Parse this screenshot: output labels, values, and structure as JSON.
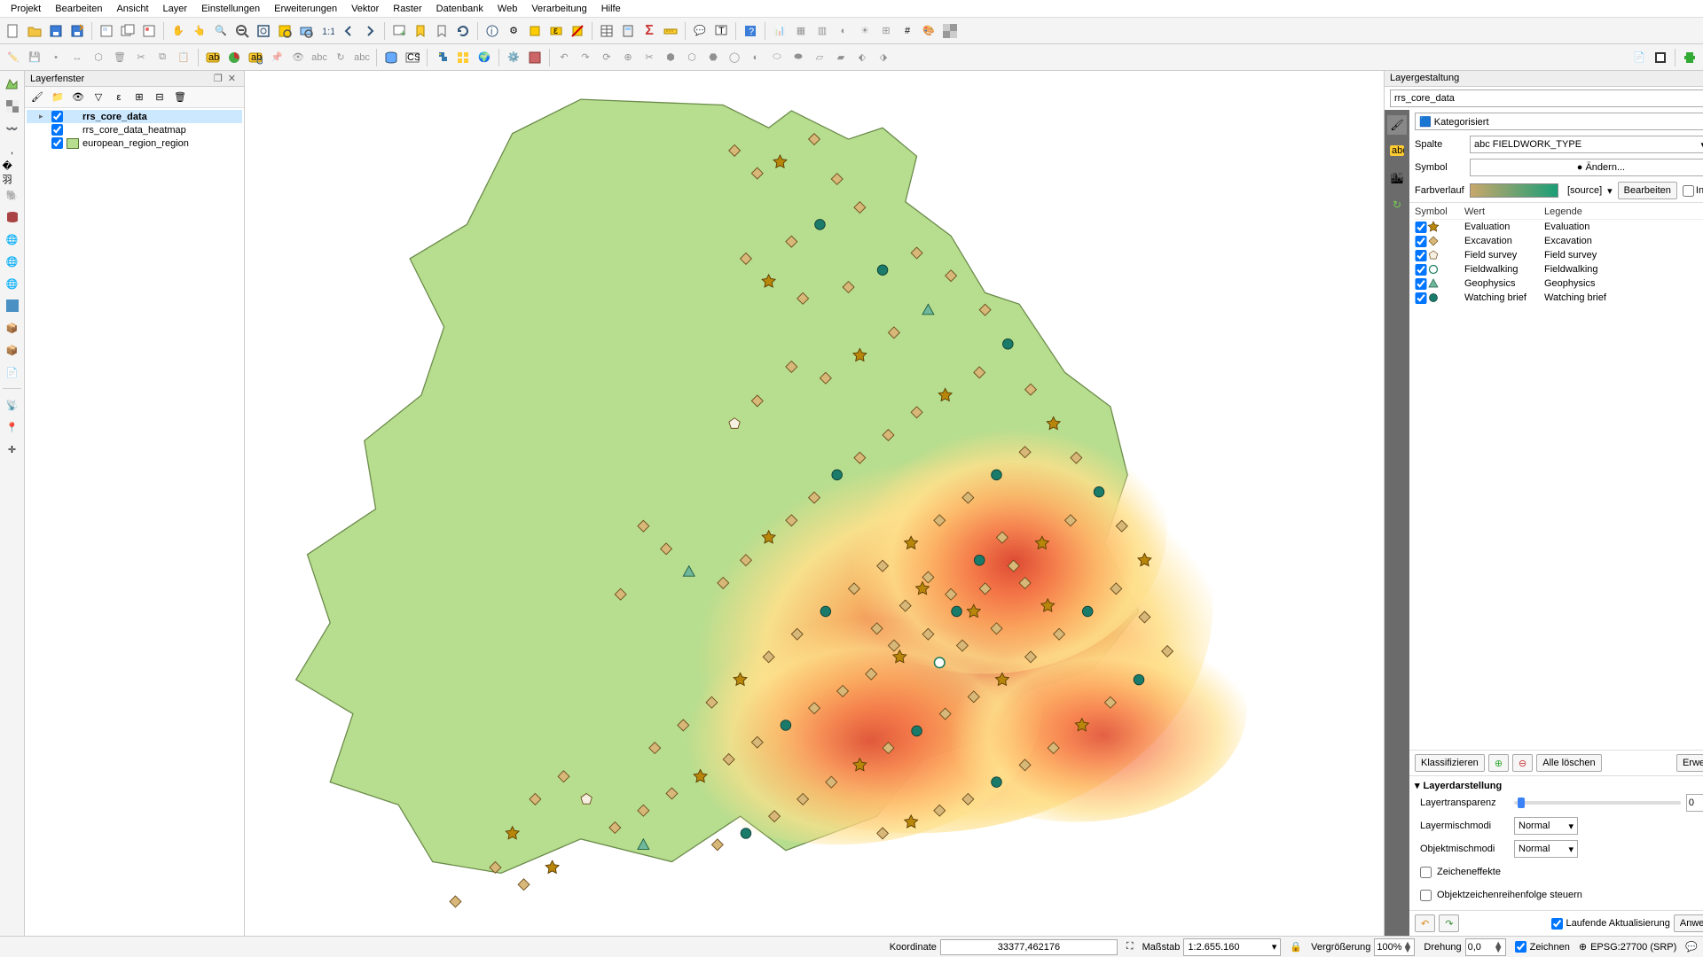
{
  "menu": [
    "Projekt",
    "Bearbeiten",
    "Ansicht",
    "Layer",
    "Einstellungen",
    "Erweiterungen",
    "Vektor",
    "Raster",
    "Datenbank",
    "Web",
    "Verarbeitung",
    "Hilfe"
  ],
  "layerpanel": {
    "title": "Layerfenster",
    "layers": [
      {
        "name": "rrs_core_data",
        "checked": true,
        "selected": true,
        "fill": "",
        "expand": "▸"
      },
      {
        "name": "rrs_core_data_heatmap",
        "checked": true,
        "fill": "",
        "expand": ""
      },
      {
        "name": "european_region_region",
        "checked": true,
        "fill": "#b7dd8e",
        "expand": ""
      }
    ]
  },
  "styling": {
    "title": "Layergestaltung",
    "layer": "rrs_core_data",
    "mode": "Kategorisiert",
    "col_label": "Spalte",
    "col_value": "abc FIELDWORK_TYPE",
    "sym_label": "Symbol",
    "sym_btn": "Ändern...",
    "ramp_label": "Farbverlauf",
    "ramp_src": "[source]",
    "ramp_edit": "Bearbeiten",
    "ramp_inv": "Invertieren",
    "heads": {
      "sym": "Symbol",
      "val": "Wert",
      "leg": "Legende"
    },
    "cats": [
      {
        "sym": "star",
        "val": "Evaluation",
        "leg": "Evaluation"
      },
      {
        "sym": "diamond",
        "val": "Excavation",
        "leg": "Excavation"
      },
      {
        "sym": "pentagon",
        "val": "Field survey",
        "leg": "Field survey"
      },
      {
        "sym": "ring",
        "val": "Fieldwalking",
        "leg": "Fieldwalking"
      },
      {
        "sym": "triangle",
        "val": "Geophysics",
        "leg": "Geophysics"
      },
      {
        "sym": "circle",
        "val": "Watching brief",
        "leg": "Watching brief"
      }
    ],
    "classify": "Klassifizieren",
    "delall": "Alle löschen",
    "adv": "Erweitert",
    "render_title": "Layerdarstellung",
    "transp": "Layertransparenz",
    "transp_val": "0",
    "blend1": "Layermischmodi",
    "blend1v": "Normal",
    "blend2": "Objektmischmodi",
    "blend2v": "Normal",
    "drawfx": "Zeicheneffekte",
    "ctrlord": "Objektzeichenreihenfolge steuern",
    "live": "Laufende Aktualisierung",
    "apply": "Anwenden"
  },
  "status": {
    "coord_label": "Koordinate",
    "coord": "33377,462176",
    "scale_label": "Maßstab",
    "scale": "1:2.655.160",
    "mag_label": "Vergrößerung",
    "mag": "100%",
    "rot_label": "Drehung",
    "rot": "0,0",
    "render": "Zeichnen",
    "crs": "EPSG:27700 (SRP)"
  }
}
